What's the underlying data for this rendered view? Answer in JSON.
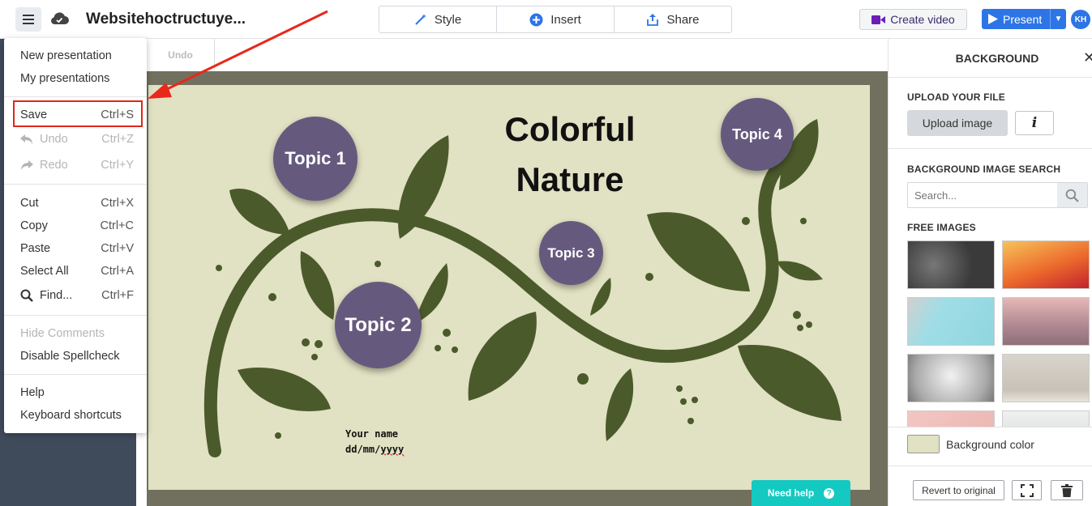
{
  "header": {
    "doc_title": "Websitehoctructuye...",
    "tabs": [
      {
        "label": "Style",
        "icon": "magic-wand-icon"
      },
      {
        "label": "Insert",
        "icon": "plus-circle-icon"
      },
      {
        "label": "Share",
        "icon": "share-icon"
      }
    ],
    "create_video": "Create video",
    "present": "Present",
    "avatar_initials": "KH"
  },
  "editor": {
    "undo_label": "Undo",
    "need_help": "Need help",
    "need_help_icon": "?"
  },
  "slide": {
    "title_line1": "Colorful",
    "title_line2": "Nature",
    "topics": [
      "Topic 1",
      "Topic 2",
      "Topic 3",
      "Topic 4"
    ],
    "name_line": "Your name",
    "date_prefix": "dd/mm/",
    "date_suffix": "yyyy",
    "colors": {
      "background": "#e1e1c3",
      "leaves": "#4b5a2b",
      "topic": "#655a7e"
    }
  },
  "menu": {
    "items": [
      {
        "label": "New presentation",
        "shortcut": ""
      },
      {
        "label": "My presentations",
        "shortcut": ""
      },
      {
        "label": "Save",
        "shortcut": "Ctrl+S"
      },
      {
        "label": "Undo",
        "shortcut": "Ctrl+Z"
      },
      {
        "label": "Redo",
        "shortcut": "Ctrl+Y"
      },
      {
        "label": "Cut",
        "shortcut": "Ctrl+X"
      },
      {
        "label": "Copy",
        "shortcut": "Ctrl+C"
      },
      {
        "label": "Paste",
        "shortcut": "Ctrl+V"
      },
      {
        "label": "Select All",
        "shortcut": "Ctrl+A"
      },
      {
        "label": "Find...",
        "shortcut": "Ctrl+F"
      },
      {
        "label": "Hide Comments",
        "shortcut": ""
      },
      {
        "label": "Disable Spellcheck",
        "shortcut": ""
      },
      {
        "label": "Help",
        "shortcut": ""
      },
      {
        "label": "Keyboard shortcuts",
        "shortcut": ""
      }
    ]
  },
  "panel": {
    "title": "BACKGROUND",
    "close_icon": "✕",
    "upload_heading": "UPLOAD YOUR FILE",
    "upload_button": "Upload image",
    "info_button": "i",
    "search_heading": "BACKGROUND IMAGE SEARCH",
    "search_placeholder": "Search...",
    "free_images_heading": "FREE IMAGES",
    "images": [
      "world-map-dark",
      "orange-sunset",
      "laptop-coffee-teal",
      "pink-lake-mountain",
      "gray-vignette",
      "plant-white-room",
      "pink-marble",
      "misty-forest"
    ],
    "background_color_label": "Background color",
    "revert_button": "Revert to original",
    "background_color": "#e1e1c3"
  }
}
